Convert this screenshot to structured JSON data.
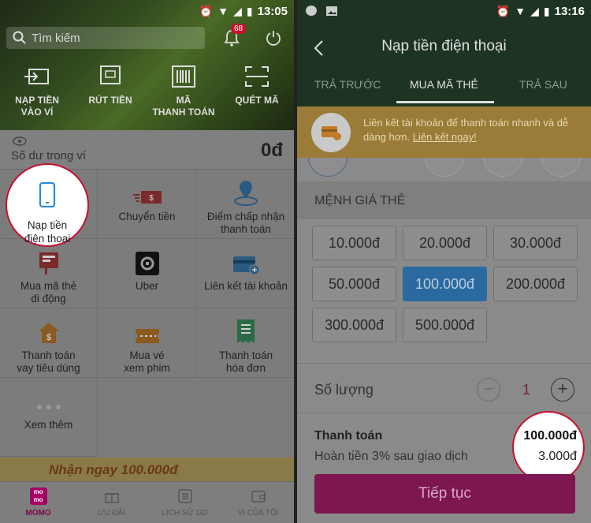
{
  "left": {
    "status": {
      "time": "13:05"
    },
    "search": {
      "placeholder": "Tìm kiếm"
    },
    "notifications": {
      "count": "68"
    },
    "quick_actions": [
      {
        "label1": "NẠP TIỀN",
        "label2": "VÀO VÍ",
        "icon": "wallet-in-icon"
      },
      {
        "label1": "RÚT TIỀN",
        "label2": "",
        "icon": "atm-withdraw-icon"
      },
      {
        "label1": "MÃ",
        "label2": "THANH TOÁN",
        "icon": "barcode-icon"
      },
      {
        "label1": "QUÉT MÃ",
        "label2": "",
        "icon": "scan-icon"
      }
    ],
    "balance": {
      "label": "Số dư trong ví",
      "amount": "0đ"
    },
    "services": [
      {
        "l1": "Nạp tiền",
        "l2": "điện thoại"
      },
      {
        "l1": "Chuyển tiền",
        "l2": ""
      },
      {
        "l1": "Điểm chấp nhận",
        "l2": "thanh toán"
      },
      {
        "l1": "Mua mã thẻ",
        "l2": "di động"
      },
      {
        "l1": "Uber",
        "l2": ""
      },
      {
        "l1": "Liên kết tài khoản",
        "l2": ""
      },
      {
        "l1": "Thanh toán",
        "l2": "vay tiêu dùng"
      },
      {
        "l1": "Mua vé",
        "l2": "xem phim"
      },
      {
        "l1": "Thanh toán",
        "l2": "hóa đơn"
      },
      {
        "l1": "Xem thêm",
        "l2": ""
      }
    ],
    "banner": {
      "text": "Nhận ngay 100.000đ"
    },
    "tabs": [
      {
        "label": "MOMO",
        "logo": "mo\nmo"
      },
      {
        "label": "ƯU ĐÃI"
      },
      {
        "label": "LỊCH SỬ GD"
      },
      {
        "label": "VÍ CỦA TÔI"
      }
    ]
  },
  "right": {
    "status": {
      "time": "13:16"
    },
    "title": "Nạp tiền điện thoại",
    "tabs": [
      "TRẢ TRƯỚC",
      "MUA MÃ THẺ",
      "TRẢ SAU"
    ],
    "alert": {
      "text": "Liên kết tài khoản để thanh toán nhanh và dễ dàng hơn.",
      "link": "Liên kết ngay!"
    },
    "section_title": "MỆNH GIÁ THẺ",
    "denominations": [
      "10.000đ",
      "20.000đ",
      "30.000đ",
      "50.000đ",
      "100.000đ",
      "200.000đ",
      "300.000đ",
      "500.000đ"
    ],
    "selected_denomination": "100.000đ",
    "quantity": {
      "label": "Số lượng",
      "value": "1",
      "minus": "−",
      "plus": "+"
    },
    "payment": {
      "label": "Thanh toán",
      "amount": "100.000đ",
      "cashback_label": "Hoàn tiền 3% sau giao dịch",
      "cashback": "3.000đ"
    },
    "continue_label": "Tiếp tục"
  },
  "colors": {
    "brand": "#a50064",
    "highlight_ring": "#c8102e",
    "selected": "#2a6aa0"
  }
}
